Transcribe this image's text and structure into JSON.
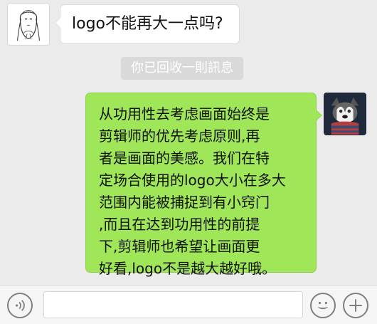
{
  "chat": {
    "left_message": {
      "text": "logo不能再大一点吗?"
    },
    "system_notice": {
      "text": "你已回收一則訊息"
    },
    "right_message": {
      "lines": [
        "从功用性去考虑画面始终是",
        "剪辑师的优先考虑原则,再",
        "者是画面的美感。我们在特",
        "定场合使用的logo大小在多大",
        "范围内能被捕捉到有小窍门",
        ",而且在达到功用性的前提",
        "下,剪辑师也希望让画面更",
        "好看,logo不是越大越好哦。"
      ]
    }
  },
  "input_bar": {
    "voice_button_icon": "voice-icon",
    "emoji_button_icon": "smile-icon",
    "plus_button_icon": "plus-icon"
  },
  "colors": {
    "chat_background": "#ebebeb",
    "left_bubble": "#ffffff",
    "right_bubble": "#9fe658",
    "system_notice": "#d9d9d9",
    "bottom_bar": "#f5f5f5"
  }
}
